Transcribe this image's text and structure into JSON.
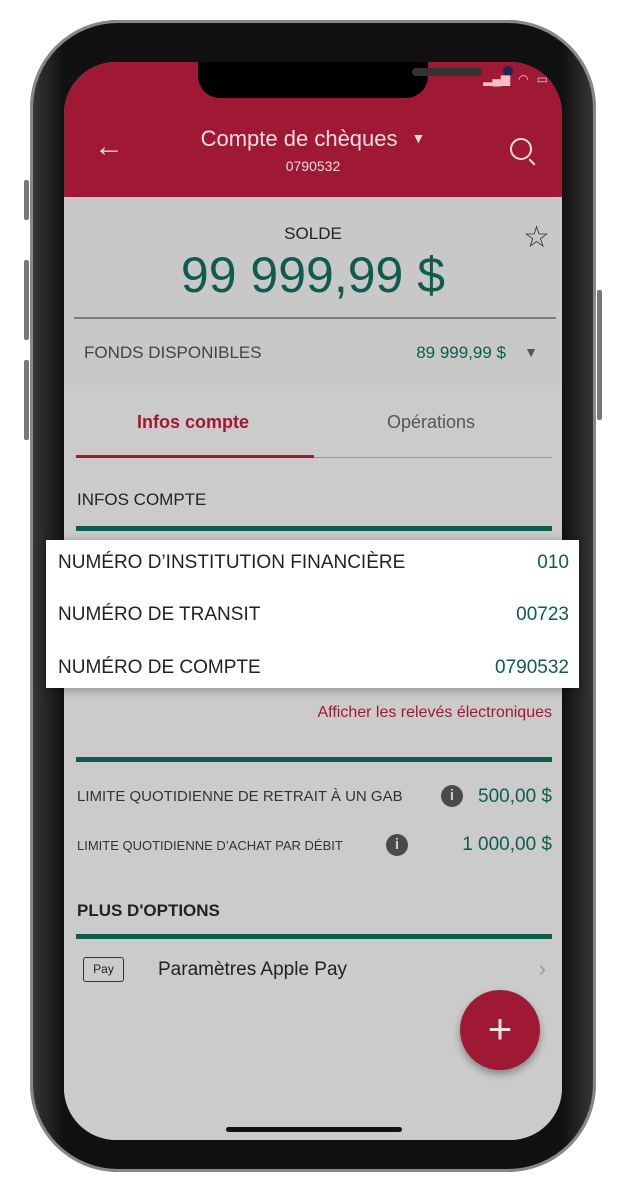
{
  "header": {
    "title": "Compte de chèques",
    "account": "0790532"
  },
  "balance": {
    "label": "SOLDE",
    "amount": "99 999,99 $"
  },
  "available": {
    "label": "FONDS DISPONIBLES",
    "amount": "89 999,99 $"
  },
  "tabs": [
    {
      "label": "Infos compte",
      "active": true
    },
    {
      "label": "Opérations",
      "active": false
    }
  ],
  "info": {
    "heading": "INFOS COMPTE",
    "rows": [
      {
        "label": "NUMÉRO D’INSTITUTION FINANCIÈRE",
        "value": "010"
      },
      {
        "label": "NUMÉRO DE TRANSIT",
        "value": "00723"
      },
      {
        "label": "NUMÉRO DE COMPTE",
        "value": "0790532"
      }
    ],
    "link": "Afficher les relevés électroniques"
  },
  "limits": [
    {
      "label": "LIMITE QUOTIDIENNE DE RETRAIT À UN GAB",
      "value": "500,00 $"
    },
    {
      "label": "LIMITE QUOTIDIENNE D’ACHAT PAR DÉBIT",
      "value": "1 000,00 $"
    }
  ],
  "options": {
    "heading": "PLUS D'OPTIONS",
    "badge": "Pay",
    "item": "Paramètres Apple Pay"
  },
  "colors": {
    "brand": "#9f1934",
    "accent": "#0f5c4f"
  }
}
